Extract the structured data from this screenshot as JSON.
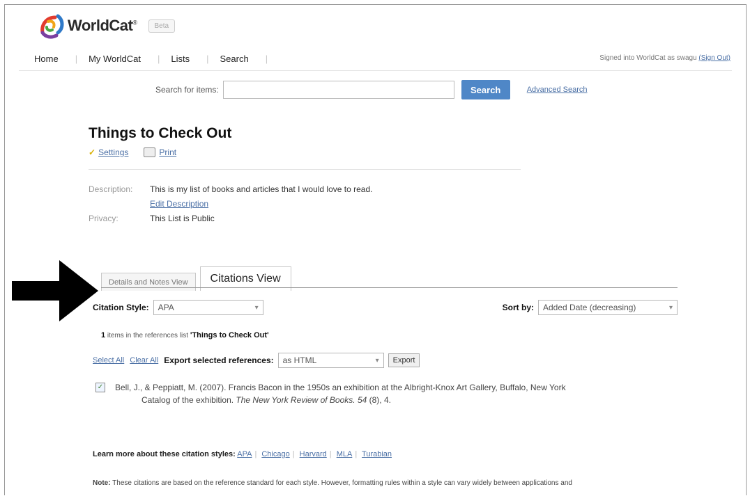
{
  "header": {
    "logo_text": "WorldCat",
    "logo_mark": "®",
    "beta_label": "Beta"
  },
  "nav": {
    "items": [
      "Home",
      "My WorldCat",
      "Lists",
      "Search"
    ],
    "signed_in_text": "Signed into WorldCat as swagu",
    "sign_out_label": "(Sign Out)"
  },
  "search": {
    "label": "Search for items:",
    "value": "",
    "button_label": "Search",
    "advanced_link": "Advanced Search"
  },
  "list": {
    "title": "Things to Check Out",
    "settings_label": "Settings",
    "print_label": "Print",
    "description_key": "Description:",
    "description_value": "This is my list of books and articles that I would love to read.",
    "edit_description_link": "Edit Description",
    "privacy_key": "Privacy:",
    "privacy_value": "This List is Public"
  },
  "tabs": {
    "details": "Details and Notes View",
    "citations": "Citations View"
  },
  "citations": {
    "style_label": "Citation Style:",
    "style_value": "APA",
    "sort_label": "Sort by:",
    "sort_value": "Added Date (decreasing)",
    "count_number": "1",
    "count_text": " items in the references list ",
    "count_list_name": "'Things to Check Out'",
    "select_all": "Select All",
    "clear_all": "Clear All",
    "export_label": "Export selected references:",
    "export_format": "as HTML",
    "export_button": "Export",
    "entry_line1": "Bell, J., & Peppiatt, M. (2007). Francis Bacon in the 1950s an exhibition at the Albright-Knox Art Gallery, Buffalo, New York",
    "entry_line2_start": "Catalog of the exhibition. ",
    "entry_journal": "The New York Review of Books. 54",
    "entry_line2_end": " (8), 4."
  },
  "footer": {
    "learn_label": "Learn more about these citation styles:",
    "styles": [
      "APA",
      "Chicago",
      "Harvard",
      "MLA",
      "Turabian"
    ],
    "note_label": "Note:",
    "note_text": " These citations are based on the reference standard for each style. However, formatting rules within a style can vary widely between applications and"
  },
  "colors": {
    "link": "#4a6fa5",
    "search_button": "#4f87c7"
  }
}
